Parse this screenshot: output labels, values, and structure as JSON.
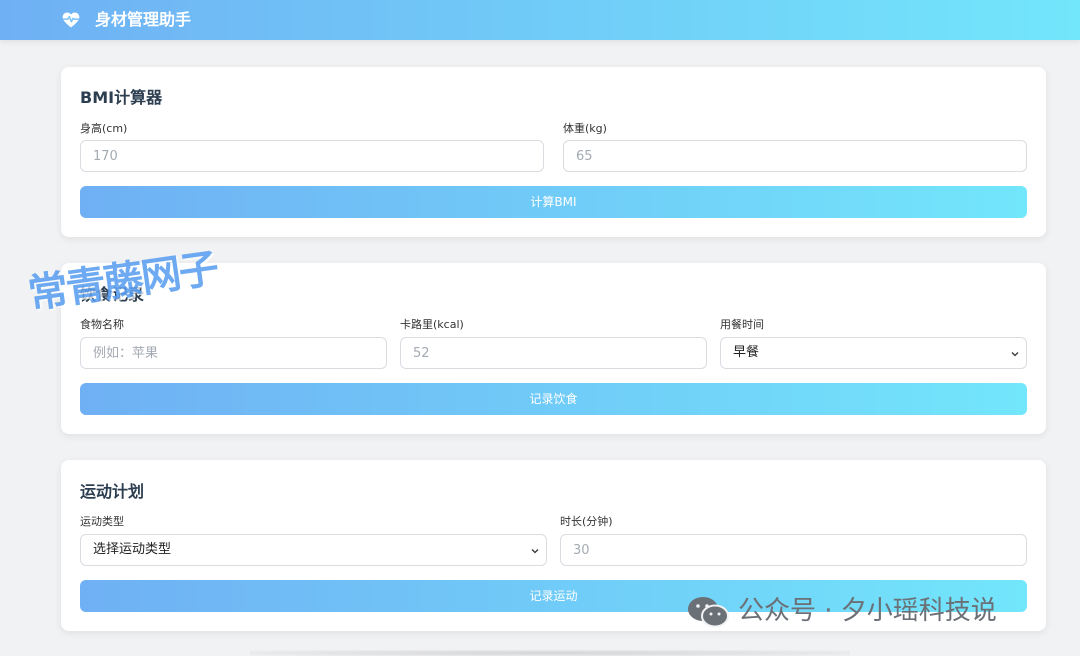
{
  "app": {
    "title": "身材管理助手",
    "brand_icon": "heart-pulse-icon",
    "accent_gradient": [
      "#6fb0f4",
      "#72e6fb"
    ]
  },
  "bmi": {
    "title": "BMI计算器",
    "height_label": "身高(cm)",
    "height_placeholder": "170",
    "weight_label": "体重(kg)",
    "weight_placeholder": "65",
    "button": "计算BMI"
  },
  "diet": {
    "title": "饮食记录",
    "food_label": "食物名称",
    "food_placeholder": "例如：苹果",
    "cal_label": "卡路里(kcal)",
    "cal_placeholder": "52",
    "meal_label": "用餐时间",
    "meal_selected": "早餐",
    "button": "记录饮食"
  },
  "exercise": {
    "title": "运动计划",
    "type_label": "运动类型",
    "type_selected": "选择运动类型",
    "duration_label": "时长(分钟)",
    "duration_placeholder": "30",
    "button": "记录运动"
  },
  "watermarks": {
    "left": "常青藤网子",
    "right": "公众号 · 夕小瑶科技说",
    "right_icon": "wechat-icon"
  }
}
